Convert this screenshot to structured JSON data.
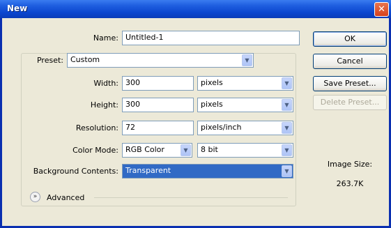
{
  "window": {
    "title": "New",
    "close_glyph": "✕"
  },
  "form": {
    "name_label": "Name:",
    "name_value": "Untitled-1",
    "preset_label": "Preset:",
    "preset_value": "Custom",
    "width_label": "Width:",
    "width_value": "300",
    "width_unit": "pixels",
    "height_label": "Height:",
    "height_value": "300",
    "height_unit": "pixels",
    "resolution_label": "Resolution:",
    "resolution_value": "72",
    "resolution_unit": "pixels/inch",
    "color_mode_label": "Color Mode:",
    "color_mode_value": "RGB Color",
    "bit_depth_value": "8 bit",
    "background_label": "Background Contents:",
    "background_value": "Transparent",
    "advanced_label": "Advanced",
    "advanced_icon": "double-chevron-down-icon"
  },
  "buttons": {
    "ok": "OK",
    "cancel": "Cancel",
    "save_preset": "Save Preset...",
    "delete_preset": "Delete Preset..."
  },
  "image_size": {
    "label": "Image Size:",
    "value": "263.7K"
  },
  "colors": {
    "titlebar": "#0b46cf",
    "dialog_bg": "#ece9d8",
    "selection": "#316ac5"
  }
}
